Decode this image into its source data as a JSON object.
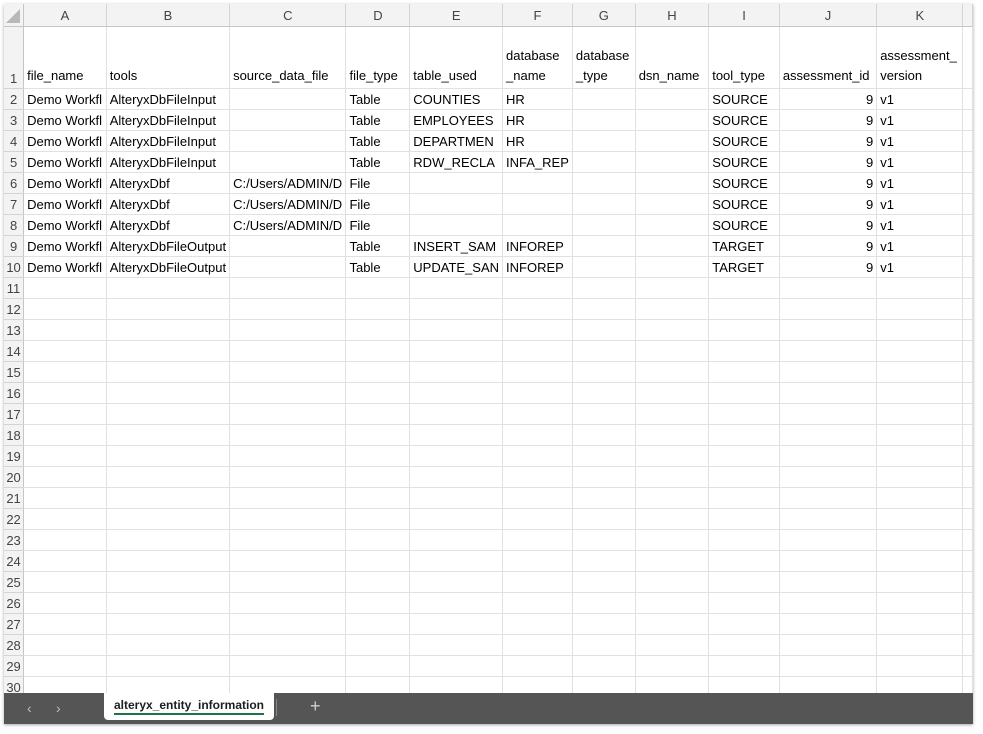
{
  "columns": [
    "A",
    "B",
    "C",
    "D",
    "E",
    "F",
    "G",
    "H",
    "I",
    "J",
    "K"
  ],
  "headers": [
    "file_name",
    "tools",
    "source_data_file",
    "file_type",
    "table_used",
    "database _name",
    "database _type",
    "dsn_name",
    "tool_type",
    "assessment_id",
    "assessment_ version"
  ],
  "rows": [
    [
      "Demo Workfl",
      "AlteryxDbFileInput",
      "",
      "Table",
      "COUNTIES",
      "HR",
      "",
      "",
      "SOURCE",
      "9",
      "v1"
    ],
    [
      "Demo Workfl",
      "AlteryxDbFileInput",
      "",
      "Table",
      "EMPLOYEES",
      "HR",
      "",
      "",
      "SOURCE",
      "9",
      "v1"
    ],
    [
      "Demo Workfl",
      "AlteryxDbFileInput",
      "",
      "Table",
      "DEPARTMEN",
      "HR",
      "",
      "",
      "SOURCE",
      "9",
      "v1"
    ],
    [
      "Demo Workfl",
      "AlteryxDbFileInput",
      "",
      "Table",
      "RDW_RECLA",
      "INFA_REP",
      "",
      "",
      "SOURCE",
      "9",
      "v1"
    ],
    [
      "Demo Workfl",
      "AlteryxDbf",
      "C:/Users/ADMIN/D",
      "File",
      "",
      "",
      "",
      "",
      "SOURCE",
      "9",
      "v1"
    ],
    [
      "Demo Workfl",
      "AlteryxDbf",
      "C:/Users/ADMIN/D",
      "File",
      "",
      "",
      "",
      "",
      "SOURCE",
      "9",
      "v1"
    ],
    [
      "Demo Workfl",
      "AlteryxDbf",
      "C:/Users/ADMIN/D",
      "File",
      "",
      "",
      "",
      "",
      "SOURCE",
      "9",
      "v1"
    ],
    [
      "Demo Workfl",
      "AlteryxDbFileOutput",
      "",
      "Table",
      "INSERT_SAM",
      "INFOREP",
      "",
      "",
      "TARGET",
      "9",
      "v1"
    ],
    [
      "Demo Workfl",
      "AlteryxDbFileOutput",
      "",
      "Table",
      "UPDATE_SAN",
      "INFOREP",
      "",
      "",
      "TARGET",
      "9",
      "v1"
    ]
  ],
  "row_numbers": [
    "1",
    "2",
    "3",
    "4",
    "5",
    "6",
    "7",
    "8",
    "9",
    "10",
    "11",
    "12",
    "13",
    "14",
    "15",
    "16",
    "17",
    "18",
    "19",
    "20",
    "21",
    "22",
    "23",
    "24",
    "25",
    "26",
    "27",
    "28",
    "29",
    "30"
  ],
  "tabs": {
    "prev": "‹",
    "next": "›",
    "active_sheet": "alteryx_entity_information",
    "add": "+"
  }
}
